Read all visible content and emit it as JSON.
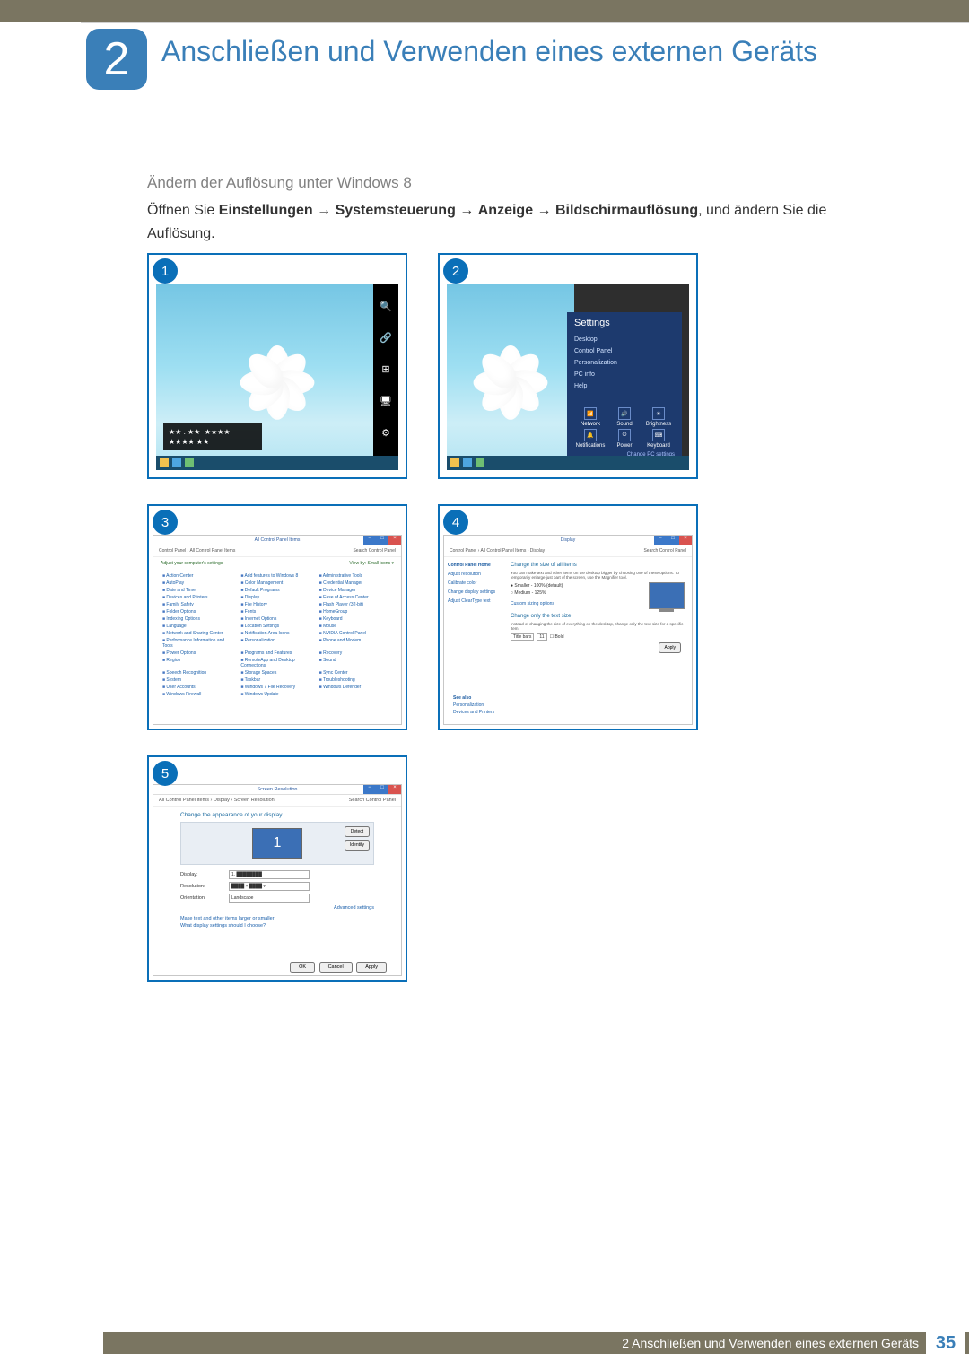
{
  "chapter": {
    "number": "2",
    "title": "Anschließen und Verwenden eines externen Geräts"
  },
  "section_heading": "Ändern der Auflösung unter Windows 8",
  "instruction": {
    "prefix": "Öffnen Sie ",
    "p1": "Einstellungen",
    "p2": "Systemsteuerung",
    "p3": "Anzeige",
    "p4": "Bildschirmauflösung",
    "suffix": ", und ändern Sie die Auflösung.",
    "arrow": "→"
  },
  "steps": {
    "s1": "1",
    "s2": "2",
    "s3": "3",
    "s4": "4",
    "s5": "5"
  },
  "overlay": {
    "line1": "★★ . ★★",
    "line2": "★★★★",
    "line3": "★★★★ ★★"
  },
  "settings_panel": {
    "title": "Settings",
    "items": [
      "Desktop",
      "Control Panel",
      "Personalization",
      "PC info",
      "Help"
    ],
    "grid": [
      "Network",
      "Sound",
      "Brightness",
      "Notifications",
      "Power",
      "Keyboard"
    ],
    "link": "Change PC settings"
  },
  "control_panel": {
    "title": "All Control Panel Items",
    "crumb_left": "Control Panel › All Control Panel Items",
    "crumb_right": "Search Control Panel",
    "sub_left": "Adjust your computer's settings",
    "sub_right": "View by: Small icons ▾",
    "items": [
      "Action Center",
      "Add features to Windows 8",
      "Administrative Tools",
      "AutoPlay",
      "Color Management",
      "Credential Manager",
      "Date and Time",
      "Default Programs",
      "Device Manager",
      "Devices and Printers",
      "Display",
      "Ease of Access Center",
      "Family Safety",
      "File History",
      "Flash Player (32-bit)",
      "Folder Options",
      "Fonts",
      "HomeGroup",
      "Indexing Options",
      "Internet Options",
      "Keyboard",
      "Language",
      "Location Settings",
      "Mouse",
      "Network and Sharing Center",
      "Notification Area Icons",
      "NVIDIA Control Panel",
      "Performance Information and Tools",
      "Personalization",
      "Phone and Modem",
      "Power Options",
      "Programs and Features",
      "Recovery",
      "Region",
      "RemoteApp and Desktop Connections",
      "Sound",
      "Speech Recognition",
      "Storage Spaces",
      "Sync Center",
      "System",
      "Taskbar",
      "Troubleshooting",
      "User Accounts",
      "Windows 7 File Recovery",
      "Windows Defender",
      "Windows Firewall",
      "Windows Update"
    ]
  },
  "display_settings": {
    "title": "Display",
    "crumb_left": "Control Panel › All Control Panel Items › Display",
    "crumb_right": "Search Control Panel",
    "side_head": "Control Panel Home",
    "side": [
      "Adjust resolution",
      "Calibrate color",
      "Change display settings",
      "Adjust ClearType text"
    ],
    "h1": "Change the size of all items",
    "desc": "You can make text and other items on the desktop bigger by choosing one of these options. To temporarily enlarge just part of the screen, use the Magnifier tool.",
    "opt1": "Smaller - 100% (default)",
    "opt2": "Medium - 125%",
    "custom": "Custom sizing options",
    "h2": "Change only the text size",
    "desc2": "Instead of changing the size of everything on the desktop, change only the text size for a specific item.",
    "row_label": "Title bars",
    "row_size": "11",
    "row_bold": "Bold",
    "apply": "Apply",
    "seealso_h": "See also",
    "seealso": [
      "Personalization",
      "Devices and Printers"
    ]
  },
  "screen_resolution": {
    "title": "Screen Resolution",
    "crumb_left": "All Control Panel Items › Display › Screen Resolution",
    "crumb_right": "Search Control Panel",
    "h1": "Change the appearance of your display",
    "detect": "Detect",
    "identify": "Identify",
    "display_label": "Display:",
    "display_value": "1. ████████",
    "res_label": "Resolution:",
    "res_value": "████ × ████ ▾",
    "orient_label": "Orientation:",
    "orient_value": "Landscape",
    "advanced": "Advanced settings",
    "link1": "Make text and other items larger or smaller",
    "link2": "What display settings should I choose?",
    "ok": "OK",
    "cancel": "Cancel",
    "apply": "Apply",
    "mon_num": "1"
  },
  "footer": {
    "text": "2 Anschließen und Verwenden eines externen Geräts",
    "page": "35"
  }
}
